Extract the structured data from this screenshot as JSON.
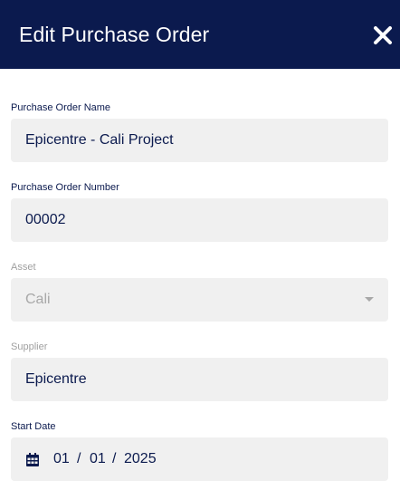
{
  "dialog": {
    "title": "Edit Purchase Order",
    "close_icon": "close-icon"
  },
  "fields": {
    "po_name": {
      "label": "Purchase Order Name",
      "value": "Epicentre - Cali Project"
    },
    "po_number": {
      "label": "Purchase Order Number",
      "value": "00002"
    },
    "asset": {
      "label": "Asset",
      "value": "Cali",
      "disabled": true,
      "caret_icon": "caret-down-icon"
    },
    "supplier": {
      "label": "Supplier",
      "value": "Epicentre",
      "disabled": true
    },
    "start_date": {
      "label": "Start Date",
      "icon": "calendar-icon",
      "month": "01",
      "day": "01",
      "year": "2025",
      "separator": "/"
    }
  },
  "colors": {
    "header_bg": "#0b1a4e",
    "text_primary": "#0b1a4e",
    "field_bg": "#f0f0f0",
    "disabled_text": "#a8a8a8"
  }
}
